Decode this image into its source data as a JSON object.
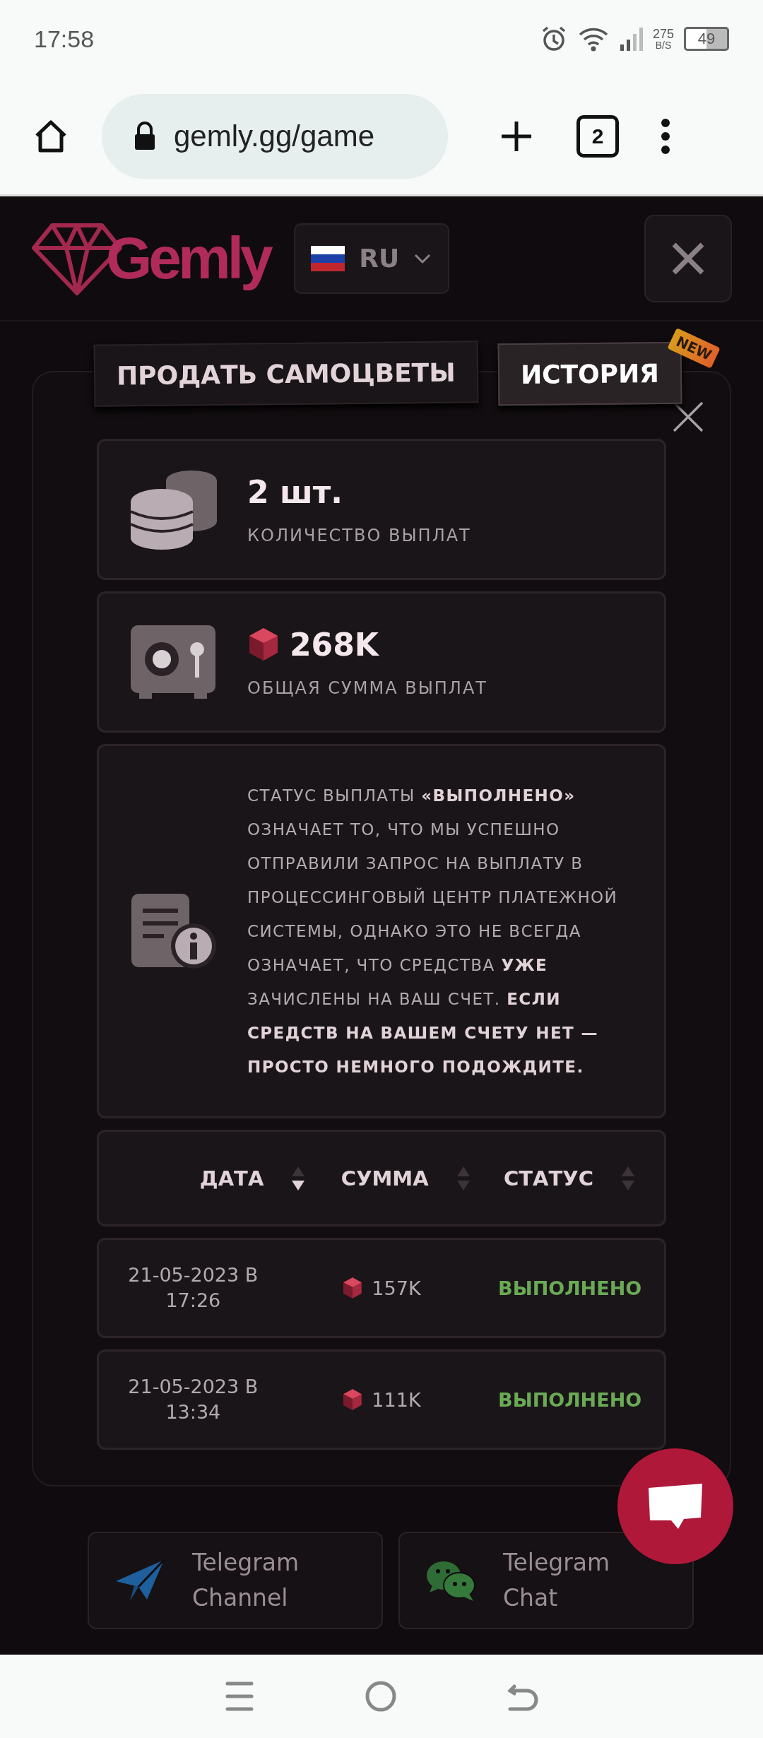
{
  "status_bar": {
    "time": "17:58",
    "net_speed": "275",
    "net_unit": "B/S",
    "battery": "49"
  },
  "browser": {
    "url": "gemly.gg/game",
    "tab_count": "2"
  },
  "header": {
    "logo": "Gemly",
    "language": "RU"
  },
  "tabs": [
    {
      "label": "ПРОДАТЬ САМОЦВЕТЫ",
      "selected": false
    },
    {
      "label": "ИСТОРИЯ",
      "selected": true,
      "badge": "NEW"
    }
  ],
  "stats": [
    {
      "kind": "count",
      "value": "2 шт.",
      "label": "КОЛИЧЕСТВО ВЫПЛАТ"
    },
    {
      "kind": "sum",
      "value": "268K",
      "label": "ОБЩАЯ СУММА ВЫПЛАТ"
    }
  ],
  "notice": "СТАТУС ВЫПЛАТЫ **«ВЫПОЛНЕНО»** ОЗНАЧАЕТ ТО, ЧТО МЫ УСПЕШНО ОТПРАВИЛИ ЗАПРОС НА ВЫПЛАТУ В ПРОЦЕССИНГОВЫЙ ЦЕНТР ПЛАТЕЖНОЙ СИСТЕМЫ, ОДНАКО ЭТО НЕ ВСЕГДА ОЗНАЧАЕТ, ЧТО СРЕДСТВА **УЖЕ** ЗАЧИСЛЕНЫ НА ВАШ СЧЕТ. **ЕСЛИ СРЕДСТВ НА ВАШЕМ СЧЕТУ НЕТ — ПРОСТО НЕМНОГО ПОДОЖДИТЕ.**",
  "table": {
    "columns": [
      {
        "label": "ДАТА",
        "sorted": true
      },
      {
        "label": "СУММА",
        "sorted": false
      },
      {
        "label": "СТАТУС",
        "sorted": false
      }
    ],
    "rows": [
      {
        "date": "21-05-2023 В 17:26",
        "amount": "157K",
        "status": "ВЫПОЛНЕНО"
      },
      {
        "date": "21-05-2023 В 13:34",
        "amount": "111K",
        "status": "ВЫПОЛНЕНО"
      }
    ]
  },
  "links": [
    {
      "kind": "channel",
      "label": "Telegram Channel"
    },
    {
      "kind": "chat",
      "label": "Telegram Chat"
    }
  ]
}
